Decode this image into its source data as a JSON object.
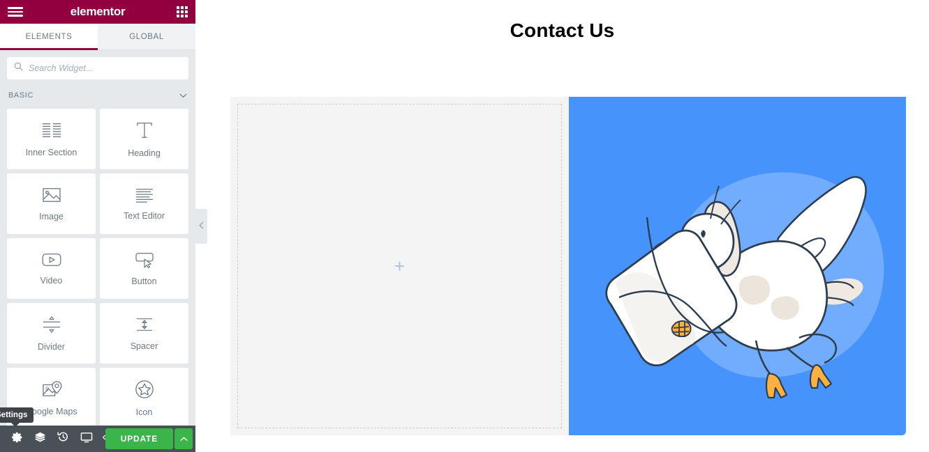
{
  "app": {
    "brand": "elementor",
    "menu_icon": "hamburger-icon",
    "widgets_panel_icon": "grid-icon"
  },
  "tabs": [
    {
      "label": "ELEMENTS",
      "active": true
    },
    {
      "label": "GLOBAL",
      "active": false
    }
  ],
  "search": {
    "placeholder": "Search Widget...",
    "value": "",
    "icon": "search-icon"
  },
  "category": {
    "title": "BASIC",
    "collapse_icon": "chevron-down-icon",
    "expanded": true
  },
  "widgets": [
    {
      "label": "Inner Section",
      "icon": "inner-section-icon"
    },
    {
      "label": "Heading",
      "icon": "heading-icon"
    },
    {
      "label": "Image",
      "icon": "image-icon"
    },
    {
      "label": "Text Editor",
      "icon": "text-editor-icon"
    },
    {
      "label": "Video",
      "icon": "video-icon"
    },
    {
      "label": "Button",
      "icon": "button-icon"
    },
    {
      "label": "Divider",
      "icon": "divider-icon"
    },
    {
      "label": "Spacer",
      "icon": "spacer-icon"
    },
    {
      "label": "Google Maps",
      "icon": "google-maps-icon"
    },
    {
      "label": "Icon",
      "icon": "star-icon"
    }
  ],
  "panel_collapse": {
    "icon": "chevron-left-icon"
  },
  "footer": {
    "buttons": [
      {
        "name": "settings",
        "icon": "gear-icon",
        "tooltip": "Settings"
      },
      {
        "name": "navigator",
        "icon": "layers-icon"
      },
      {
        "name": "history",
        "icon": "history-icon"
      },
      {
        "name": "responsive-mode",
        "icon": "desktop-icon"
      },
      {
        "name": "preview",
        "icon": "eye-icon"
      }
    ],
    "tooltip": "Settings",
    "update_label": "UPDATE",
    "update_arrow_icon": "caret-up-icon"
  },
  "canvas": {
    "page_title": "Contact Us",
    "left_column": {
      "add_icon": "plus-icon",
      "empty": true
    },
    "right_column": {
      "image": "flying-goose-illustration"
    }
  },
  "colors": {
    "brand": "#93003f",
    "panel_bg": "#e6e9ec",
    "footer_bg": "#495157",
    "update_green": "#39b54a",
    "canvas_blue": "#4693fb",
    "blob_blue": "#81b4fc",
    "icon_gray": "#6d7882",
    "goose_outline": "#2c3e50",
    "goose_beak": "#fbb040"
  }
}
